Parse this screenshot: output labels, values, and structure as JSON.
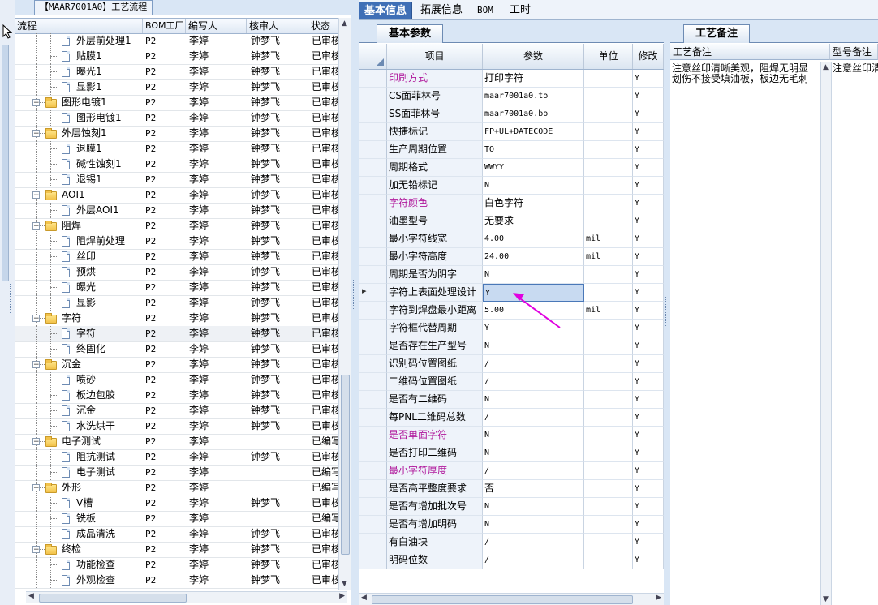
{
  "left_tab": {
    "label": "【MAAR7001A0】工艺流程"
  },
  "tree": {
    "headers": {
      "flow": "流程",
      "bom": "BOM工厂",
      "writer": "编写人",
      "reviewer": "核审人",
      "status": "状态"
    },
    "rows": [
      {
        "level": 2,
        "type": "doc",
        "name": "外层前处理1",
        "bom": "P2",
        "writer": "李婷",
        "reviewer": "钟梦飞",
        "status": "已审核"
      },
      {
        "level": 2,
        "type": "doc",
        "name": "贴膜1",
        "bom": "P2",
        "writer": "李婷",
        "reviewer": "钟梦飞",
        "status": "已审核"
      },
      {
        "level": 2,
        "type": "doc",
        "name": "曝光1",
        "bom": "P2",
        "writer": "李婷",
        "reviewer": "钟梦飞",
        "status": "已审核"
      },
      {
        "level": 2,
        "type": "doc",
        "name": "显影1",
        "bom": "P2",
        "writer": "李婷",
        "reviewer": "钟梦飞",
        "status": "已审核"
      },
      {
        "level": 1,
        "type": "folder",
        "name": "图形电镀1",
        "bom": "P2",
        "writer": "李婷",
        "reviewer": "钟梦飞",
        "status": "已审核"
      },
      {
        "level": 2,
        "type": "doc",
        "name": "图形电镀1",
        "bom": "P2",
        "writer": "李婷",
        "reviewer": "钟梦飞",
        "status": "已审核"
      },
      {
        "level": 1,
        "type": "folder",
        "name": "外层蚀刻1",
        "bom": "P2",
        "writer": "李婷",
        "reviewer": "钟梦飞",
        "status": "已审核"
      },
      {
        "level": 2,
        "type": "doc",
        "name": "退膜1",
        "bom": "P2",
        "writer": "李婷",
        "reviewer": "钟梦飞",
        "status": "已审核"
      },
      {
        "level": 2,
        "type": "doc",
        "name": "碱性蚀刻1",
        "bom": "P2",
        "writer": "李婷",
        "reviewer": "钟梦飞",
        "status": "已审核"
      },
      {
        "level": 2,
        "type": "doc",
        "name": "退锡1",
        "bom": "P2",
        "writer": "李婷",
        "reviewer": "钟梦飞",
        "status": "已审核"
      },
      {
        "level": 1,
        "type": "folder",
        "name": "AOI1",
        "bom": "P2",
        "writer": "李婷",
        "reviewer": "钟梦飞",
        "status": "已审核"
      },
      {
        "level": 2,
        "type": "doc",
        "name": "外层AOI1",
        "bom": "P2",
        "writer": "李婷",
        "reviewer": "钟梦飞",
        "status": "已审核"
      },
      {
        "level": 1,
        "type": "folder",
        "name": "阻焊",
        "bom": "P2",
        "writer": "李婷",
        "reviewer": "钟梦飞",
        "status": "已审核"
      },
      {
        "level": 2,
        "type": "doc",
        "name": "阻焊前处理",
        "bom": "P2",
        "writer": "李婷",
        "reviewer": "钟梦飞",
        "status": "已审核"
      },
      {
        "level": 2,
        "type": "doc",
        "name": "丝印",
        "bom": "P2",
        "writer": "李婷",
        "reviewer": "钟梦飞",
        "status": "已审核"
      },
      {
        "level": 2,
        "type": "doc",
        "name": "预烘",
        "bom": "P2",
        "writer": "李婷",
        "reviewer": "钟梦飞",
        "status": "已审核"
      },
      {
        "level": 2,
        "type": "doc",
        "name": "曝光",
        "bom": "P2",
        "writer": "李婷",
        "reviewer": "钟梦飞",
        "status": "已审核"
      },
      {
        "level": 2,
        "type": "doc",
        "name": "显影",
        "bom": "P2",
        "writer": "李婷",
        "reviewer": "钟梦飞",
        "status": "已审核"
      },
      {
        "level": 1,
        "type": "folder",
        "name": "字符",
        "bom": "P2",
        "writer": "李婷",
        "reviewer": "钟梦飞",
        "status": "已审核"
      },
      {
        "level": 2,
        "type": "doc",
        "name": "字符",
        "bom": "P2",
        "writer": "李婷",
        "reviewer": "钟梦飞",
        "status": "已审核",
        "selected": true
      },
      {
        "level": 2,
        "type": "doc",
        "name": "终固化",
        "bom": "P2",
        "writer": "李婷",
        "reviewer": "钟梦飞",
        "status": "已审核"
      },
      {
        "level": 1,
        "type": "folder",
        "name": "沉金",
        "bom": "P2",
        "writer": "李婷",
        "reviewer": "钟梦飞",
        "status": "已审核"
      },
      {
        "level": 2,
        "type": "doc",
        "name": "喷砂",
        "bom": "P2",
        "writer": "李婷",
        "reviewer": "钟梦飞",
        "status": "已审核"
      },
      {
        "level": 2,
        "type": "doc",
        "name": "板边包胶",
        "bom": "P2",
        "writer": "李婷",
        "reviewer": "钟梦飞",
        "status": "已审核"
      },
      {
        "level": 2,
        "type": "doc",
        "name": "沉金",
        "bom": "P2",
        "writer": "李婷",
        "reviewer": "钟梦飞",
        "status": "已审核"
      },
      {
        "level": 2,
        "type": "doc",
        "name": "水洗烘干",
        "bom": "P2",
        "writer": "李婷",
        "reviewer": "钟梦飞",
        "status": "已审核"
      },
      {
        "level": 1,
        "type": "folder",
        "name": "电子测试",
        "bom": "P2",
        "writer": "李婷",
        "reviewer": "",
        "status": "已编写"
      },
      {
        "level": 2,
        "type": "doc",
        "name": "阻抗测试",
        "bom": "P2",
        "writer": "李婷",
        "reviewer": "钟梦飞",
        "status": "已审核"
      },
      {
        "level": 2,
        "type": "doc",
        "name": "电子测试",
        "bom": "P2",
        "writer": "李婷",
        "reviewer": "",
        "status": "已编写"
      },
      {
        "level": 1,
        "type": "folder",
        "name": "外形",
        "bom": "P2",
        "writer": "李婷",
        "reviewer": "",
        "status": "已编写"
      },
      {
        "level": 2,
        "type": "doc",
        "name": "V槽",
        "bom": "P2",
        "writer": "李婷",
        "reviewer": "钟梦飞",
        "status": "已审核"
      },
      {
        "level": 2,
        "type": "doc",
        "name": "铣板",
        "bom": "P2",
        "writer": "李婷",
        "reviewer": "",
        "status": "已编写"
      },
      {
        "level": 2,
        "type": "doc",
        "name": "成品清洗",
        "bom": "P2",
        "writer": "李婷",
        "reviewer": "钟梦飞",
        "status": "已审核"
      },
      {
        "level": 1,
        "type": "folder",
        "name": "终检",
        "bom": "P2",
        "writer": "李婷",
        "reviewer": "钟梦飞",
        "status": "已审核"
      },
      {
        "level": 2,
        "type": "doc",
        "name": "功能检查",
        "bom": "P2",
        "writer": "李婷",
        "reviewer": "钟梦飞",
        "status": "已审核"
      },
      {
        "level": 2,
        "type": "doc",
        "name": "外观检查",
        "bom": "P2",
        "writer": "李婷",
        "reviewer": "钟梦飞",
        "status": "已审核"
      }
    ]
  },
  "top_tabs": [
    "基本信息",
    "拓展信息",
    "BOM",
    "工时"
  ],
  "basic": {
    "sub_tab": "基本参数",
    "headers": {
      "item": "项目",
      "param": "参数",
      "unit": "单位",
      "mod": "修改"
    },
    "rows": [
      {
        "item": "印刷方式",
        "param": "打印字符",
        "unit": "",
        "mod": "Y",
        "pink": true
      },
      {
        "item": "CS面菲林号",
        "param": "maar7001a0.to",
        "unit": "",
        "mod": "Y",
        "mono": true
      },
      {
        "item": "SS面菲林号",
        "param": "maar7001a0.bo",
        "unit": "",
        "mod": "Y",
        "mono": true
      },
      {
        "item": "快捷标记",
        "param": "FP+UL+DATECODE",
        "unit": "",
        "mod": "Y",
        "mono": true
      },
      {
        "item": "生产周期位置",
        "param": "TO",
        "unit": "",
        "mod": "Y",
        "mono": true
      },
      {
        "item": "周期格式",
        "param": "WWYY",
        "unit": "",
        "mod": "Y",
        "mono": true
      },
      {
        "item": "加无铅标记",
        "param": "N",
        "unit": "",
        "mod": "Y",
        "mono": true
      },
      {
        "item": "字符颜色",
        "param": "白色字符",
        "unit": "",
        "mod": "Y",
        "pink": true
      },
      {
        "item": "油墨型号",
        "param": "无要求",
        "unit": "",
        "mod": "Y"
      },
      {
        "item": "最小字符线宽",
        "param": "4.00",
        "unit": "mil",
        "mod": "Y",
        "mono": true
      },
      {
        "item": "最小字符高度",
        "param": "24.00",
        "unit": "mil",
        "mod": "Y",
        "mono": true
      },
      {
        "item": "周期是否为阴字",
        "param": "N",
        "unit": "",
        "mod": "Y",
        "mono": true
      },
      {
        "item": "字符上表面处理设计",
        "param": "Y",
        "unit": "",
        "mod": "Y",
        "mono": true,
        "editing": true
      },
      {
        "item": "字符到焊盘最小距离",
        "param": "5.00",
        "unit": "mil",
        "mod": "Y",
        "mono": true
      },
      {
        "item": "字符框代替周期",
        "param": "Y",
        "unit": "",
        "mod": "Y",
        "mono": true
      },
      {
        "item": "是否存在生产型号",
        "param": "N",
        "unit": "",
        "mod": "Y",
        "mono": true
      },
      {
        "item": "识别码位置图纸",
        "param": "/",
        "unit": "",
        "mod": "Y",
        "mono": true
      },
      {
        "item": "二维码位置图纸",
        "param": "/",
        "unit": "",
        "mod": "Y",
        "mono": true
      },
      {
        "item": "是否有二维码",
        "param": "N",
        "unit": "",
        "mod": "Y",
        "mono": true
      },
      {
        "item": "每PNL二维码总数",
        "param": "/",
        "unit": "",
        "mod": "Y",
        "mono": true
      },
      {
        "item": "是否单面字符",
        "param": "N",
        "unit": "",
        "mod": "Y",
        "mono": true,
        "pink": true
      },
      {
        "item": "是否打印二维码",
        "param": "N",
        "unit": "",
        "mod": "Y",
        "mono": true
      },
      {
        "item": "最小字符厚度",
        "param": "/",
        "unit": "",
        "mod": "Y",
        "mono": true,
        "pink": true
      },
      {
        "item": "是否高平整度要求",
        "param": "否",
        "unit": "",
        "mod": "Y"
      },
      {
        "item": "是否有增加批次号",
        "param": "N",
        "unit": "",
        "mod": "Y",
        "mono": true
      },
      {
        "item": "是否有增加明码",
        "param": "N",
        "unit": "",
        "mod": "Y",
        "mono": true
      },
      {
        "item": "有白油块",
        "param": "/",
        "unit": "",
        "mod": "Y",
        "mono": true
      },
      {
        "item": "明码位数",
        "param": "/",
        "unit": "",
        "mod": "Y",
        "mono": true
      }
    ]
  },
  "remark": {
    "tab": "工艺备注",
    "col1_header": "工艺备注",
    "col2_header": "型号备注",
    "col1_line1": "注意丝印清晰美观，阻焊无明显",
    "col1_line2": "划伤不接受填油板，板边无毛刺",
    "col2_line1": "注意丝印清晰"
  },
  "colors": {
    "accent": "#3f6fb6",
    "pink_label": "#b0199c",
    "annotation_arrow": "#e000e0"
  }
}
